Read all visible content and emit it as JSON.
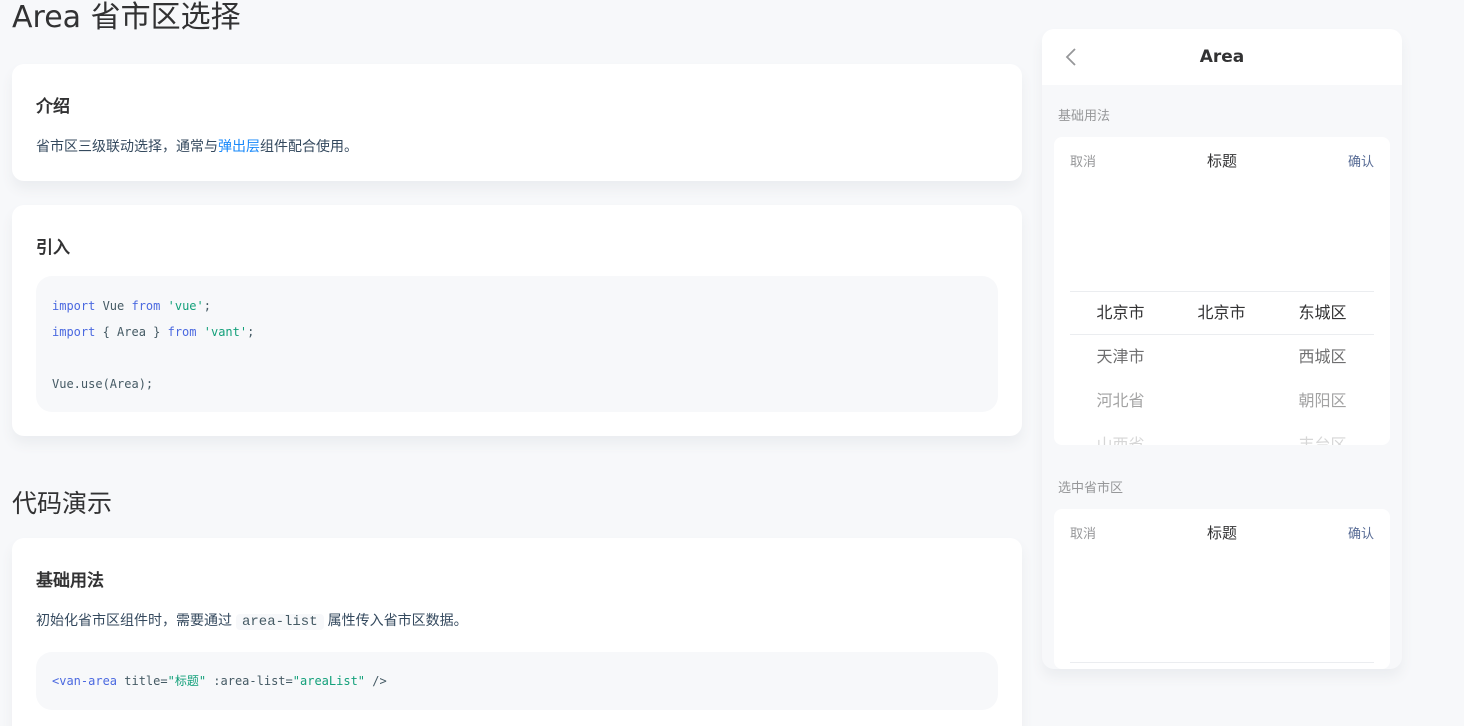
{
  "doc": {
    "title": "Area 省市区选择",
    "intro": {
      "heading": "介绍",
      "text_before": "省市区三级联动选择，通常与",
      "link": "弹出层",
      "text_after": "组件配合使用。"
    },
    "import": {
      "heading": "引入",
      "code": [
        [
          {
            "t": "import",
            "c": "kw"
          },
          {
            "t": " Vue ",
            "c": ""
          },
          {
            "t": "from",
            "c": "kw"
          },
          {
            "t": " ",
            "c": ""
          },
          {
            "t": "'vue'",
            "c": "str"
          },
          {
            "t": ";",
            "c": ""
          }
        ],
        [
          {
            "t": "import",
            "c": "kw"
          },
          {
            "t": " { Area } ",
            "c": ""
          },
          {
            "t": "from",
            "c": "kw"
          },
          {
            "t": " ",
            "c": ""
          },
          {
            "t": "'vant'",
            "c": "str"
          },
          {
            "t": ";",
            "c": ""
          }
        ],
        [],
        [
          {
            "t": "Vue.use(Area);",
            "c": ""
          }
        ]
      ]
    },
    "section_title": "代码演示",
    "basic": {
      "heading": "基础用法",
      "text_before": "初始化省市区组件时，需要通过",
      "inline_code": "area-list",
      "text_after": "属性传入省市区数据。",
      "code": [
        {
          "t": "<van-area",
          "c": "tag"
        },
        {
          "t": " title=",
          "c": ""
        },
        {
          "t": "\"标题\"",
          "c": "str"
        },
        {
          "t": " :area-list=",
          "c": ""
        },
        {
          "t": "\"areaList\"",
          "c": "str"
        },
        {
          "t": " />",
          "c": ""
        }
      ]
    }
  },
  "phone": {
    "nav_title": "Area",
    "demo1": {
      "title": "基础用法",
      "cancel": "取消",
      "picker_title": "标题",
      "confirm": "确认",
      "rows": [
        [
          "北京市",
          "北京市",
          "东城区"
        ],
        [
          "天津市",
          "",
          "西城区"
        ],
        [
          "河北省",
          "",
          "朝阳区"
        ],
        [
          "山西省",
          "",
          "丰台区"
        ]
      ]
    },
    "demo2": {
      "title": "选中省市区",
      "cancel": "取消",
      "picker_title": "标题",
      "confirm": "确认"
    }
  }
}
